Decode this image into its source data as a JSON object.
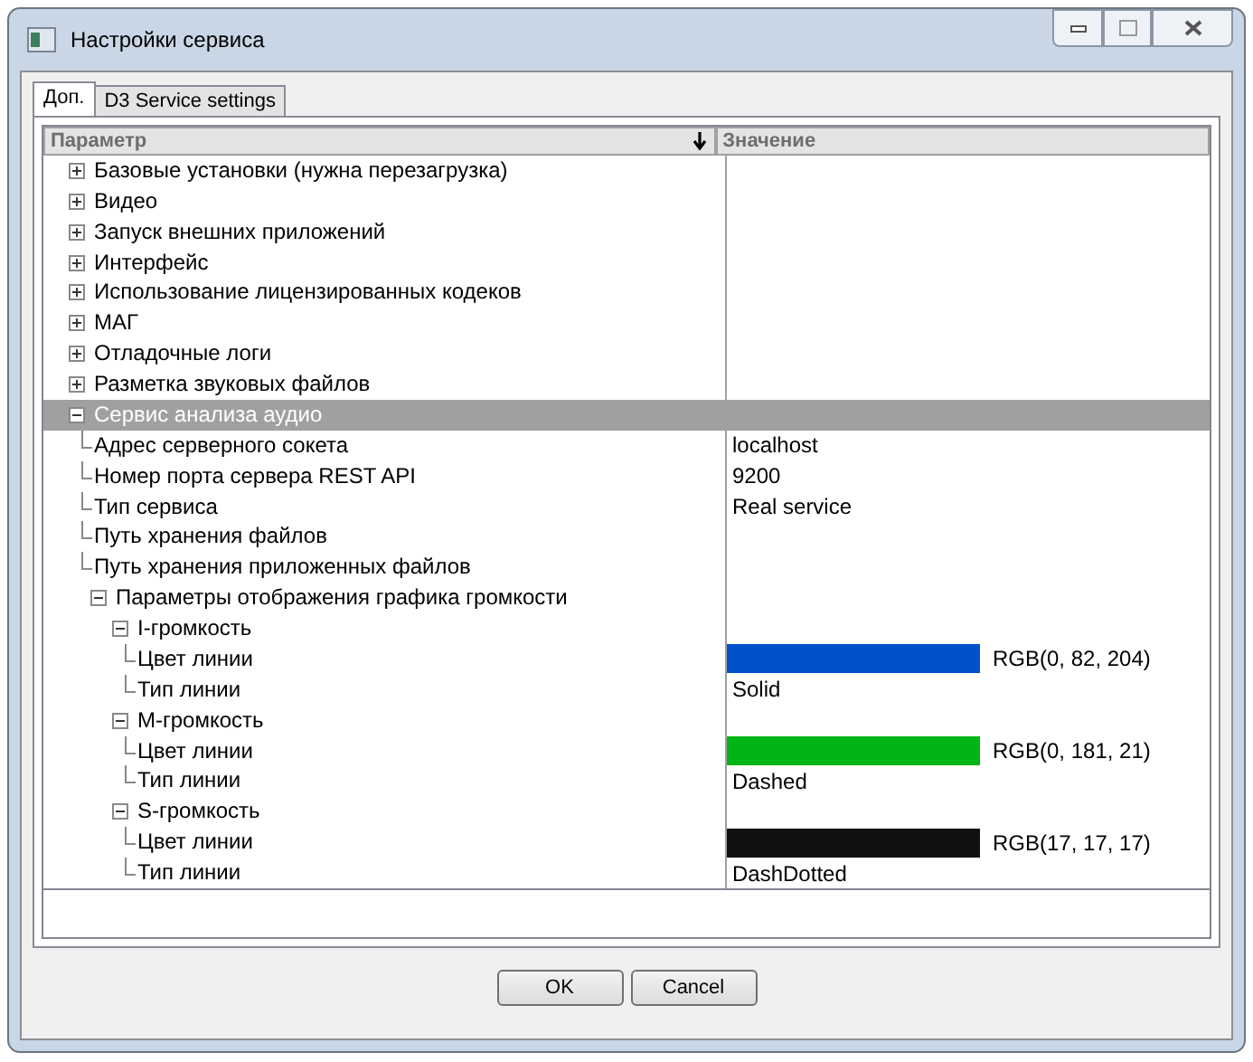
{
  "window": {
    "title": "Настройки сервиса"
  },
  "tabs": [
    {
      "label": "Доп.",
      "selected": true
    },
    {
      "label": "D3 Service settings",
      "selected": false
    }
  ],
  "grid": {
    "columns": [
      "Параметр",
      "Значение"
    ],
    "rows": [
      {
        "label": "Базовые установки (нужна перезагрузка)",
        "expanded": false,
        "selected": false
      },
      {
        "label": "Видео",
        "expanded": false,
        "selected": false
      },
      {
        "label": "Запуск внешних приложений",
        "expanded": false,
        "selected": false
      },
      {
        "label": "Интерфейс",
        "expanded": false,
        "selected": false
      },
      {
        "label": "Использование лицензированных кодеков",
        "expanded": false,
        "selected": false
      },
      {
        "label": "МАГ",
        "expanded": false,
        "selected": false
      },
      {
        "label": "Отладочные логи",
        "expanded": false,
        "selected": false
      },
      {
        "label": "Разметка звуковых файлов",
        "expanded": false,
        "selected": false
      },
      {
        "label": "Сервис анализа аудио",
        "expanded": true,
        "selected": true,
        "children": [
          {
            "label": "Адрес серверного сокета",
            "selected": false,
            "value": {
              "kind": "text",
              "text": "localhost"
            }
          },
          {
            "label": "Номер порта сервера REST API",
            "selected": false,
            "value": {
              "kind": "text",
              "text": "9200"
            }
          },
          {
            "label": "Тип сервиса",
            "selected": false,
            "value": {
              "kind": "text",
              "text": "Real service"
            }
          },
          {
            "label": "Путь хранения файлов",
            "selected": false
          },
          {
            "label": "Путь хранения приложенных файлов",
            "selected": false
          },
          {
            "label": "Параметры отображения графика громкости",
            "expanded": true,
            "selected": false,
            "children": [
              {
                "label": "I-громкость",
                "expanded": true,
                "selected": false,
                "children": [
                  {
                    "label": "Цвет линии",
                    "selected": false,
                    "value": {
                      "kind": "color",
                      "color": "#0052cc",
                      "text": "RGB(0, 82, 204)"
                    }
                  },
                  {
                    "label": "Тип линии",
                    "selected": false,
                    "value": {
                      "kind": "text",
                      "text": "Solid"
                    }
                  }
                ]
              },
              {
                "label": "M-громкость",
                "expanded": true,
                "selected": false,
                "children": [
                  {
                    "label": "Цвет линии",
                    "selected": false,
                    "value": {
                      "kind": "color",
                      "color": "#00b515",
                      "text": "RGB(0, 181, 21)"
                    }
                  },
                  {
                    "label": "Тип линии",
                    "selected": false,
                    "value": {
                      "kind": "text",
                      "text": "Dashed"
                    }
                  }
                ]
              },
              {
                "label": "S-громкость",
                "expanded": true,
                "selected": false,
                "children": [
                  {
                    "label": "Цвет линии",
                    "selected": false,
                    "value": {
                      "kind": "color",
                      "color": "#111111",
                      "text": "RGB(17, 17, 17)"
                    }
                  },
                  {
                    "label": "Тип линии",
                    "selected": false,
                    "value": {
                      "kind": "text",
                      "text": "DashDotted"
                    }
                  }
                ]
              }
            ]
          }
        ]
      }
    ]
  },
  "buttons": [
    "OK",
    "Cancel"
  ]
}
